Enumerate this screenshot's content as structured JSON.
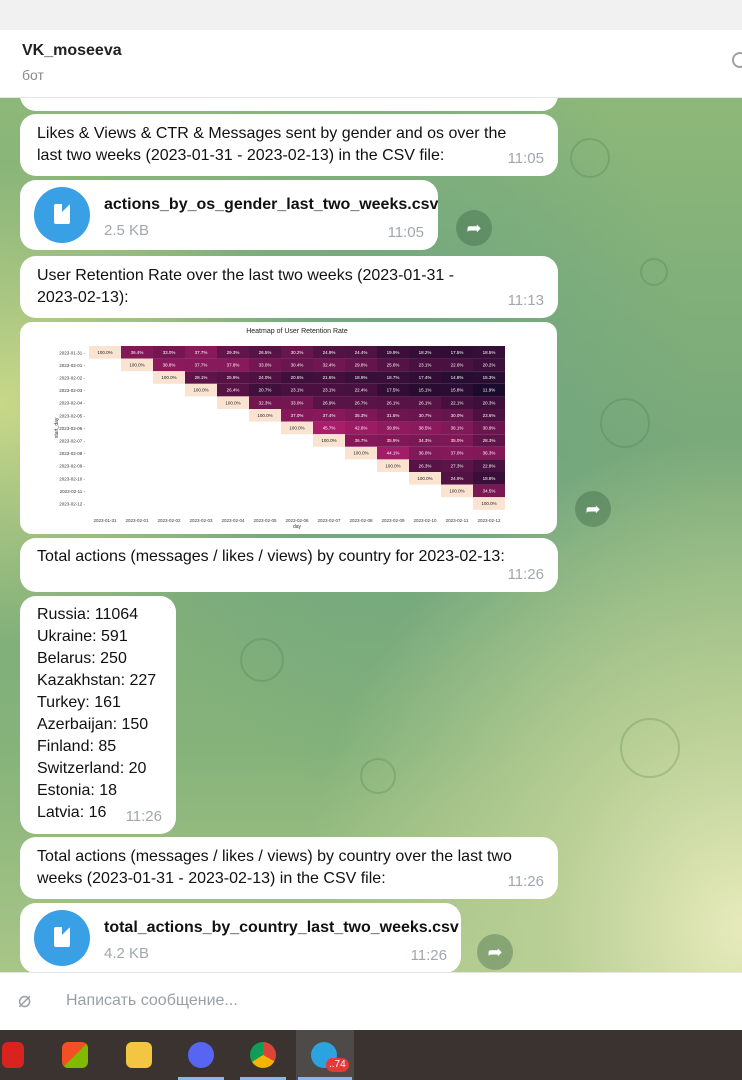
{
  "header": {
    "chat_name": "VK_moseeva",
    "chat_status": "бот"
  },
  "messages": [
    {
      "text": "Likes & Views & CTR & Messages sent by gender and os over the\nlast two weeks (2023-01-31 - 2023-02-13) in the CSV file:",
      "time": "11:05"
    },
    {
      "file_name": "actions_by_os_gender_last_two_weeks.csv",
      "file_size": "2.5 KB",
      "time": "11:05"
    },
    {
      "text": "User Retention Rate over the last two weeks (2023-01-31 -\n2023-02-13):",
      "time": "11:13"
    },
    {
      "text": "Total actions (messages / likes / views) by country for 2023-02-13:",
      "time": "11:26"
    },
    {
      "text": "Russia: 11064\nUkraine: 591\nBelarus: 250\nKazakhstan: 227\nTurkey: 161\nAzerbaijan: 150\nFinland: 85\nSwitzerland: 20\nEstonia: 18\nLatvia: 16",
      "time": "11:26"
    },
    {
      "text": "Total actions (messages / likes / views) by country over the last two\nweeks (2023-01-31 - 2023-02-13) in the CSV file:",
      "time": "11:26"
    },
    {
      "file_name": "total_actions_by_country_last_two_weeks.csv",
      "file_size": "4.2 KB",
      "time": "11:26"
    }
  ],
  "chart_data": {
    "type": "heatmap",
    "title": "Heatmap of User Retention Rate",
    "xlabel": "day",
    "ylabel": "start_day",
    "x": [
      "2023-01-31",
      "2023-02-01",
      "2023-02-02",
      "2023-02-03",
      "2023-02-04",
      "2023-02-05",
      "2023-02-06",
      "2023-02-07",
      "2023-02-08",
      "2023-02-09",
      "2023-02-10",
      "2023-02-11",
      "2023-02-12"
    ],
    "y": [
      "2023-01-31",
      "2023-02-01",
      "2023-02-02",
      "2023-02-03",
      "2023-02-04",
      "2023-02-05",
      "2023-02-06",
      "2023-02-07",
      "2023-02-08",
      "2023-02-09",
      "2023-02-10",
      "2023-02-11",
      "2023-02-12"
    ],
    "values": [
      [
        100.0,
        36.4,
        33.0,
        37.7,
        29.3,
        26.5,
        30.2,
        24.9,
        24.4,
        19.9,
        18.2,
        17.5,
        18.5
      ],
      [
        null,
        100.0,
        38.8,
        37.7,
        37.8,
        33.0,
        30.4,
        32.4,
        29.8,
        25.6,
        23.1,
        22.6,
        20.2
      ],
      [
        null,
        null,
        100.0,
        28.1,
        25.9,
        24.0,
        20.6,
        21.6,
        18.9,
        18.7,
        17.4,
        14.8,
        15.3
      ],
      [
        null,
        null,
        null,
        100.0,
        26.4,
        20.7,
        23.1,
        23.1,
        22.4,
        17.5,
        15.1,
        15.8,
        11.9
      ],
      [
        null,
        null,
        null,
        null,
        100.0,
        32.3,
        33.0,
        26.9,
        26.7,
        26.1,
        26.1,
        22.1,
        20.3
      ],
      [
        null,
        null,
        null,
        null,
        null,
        100.0,
        37.0,
        37.4,
        35.3,
        31.5,
        30.7,
        30.0,
        23.6
      ],
      [
        null,
        null,
        null,
        null,
        null,
        null,
        100.0,
        45.7,
        42.6,
        39.9,
        38.5,
        36.1,
        30.9
      ],
      [
        null,
        null,
        null,
        null,
        null,
        null,
        null,
        100.0,
        36.7,
        35.9,
        34.3,
        35.0,
        28.3
      ],
      [
        null,
        null,
        null,
        null,
        null,
        null,
        null,
        null,
        100.0,
        44.1,
        36.0,
        37.0,
        36.3
      ],
      [
        null,
        null,
        null,
        null,
        null,
        null,
        null,
        null,
        null,
        100.0,
        26.3,
        27.3,
        22.8
      ],
      [
        null,
        null,
        null,
        null,
        null,
        null,
        null,
        null,
        null,
        null,
        100.0,
        24.9,
        18.8
      ],
      [
        null,
        null,
        null,
        null,
        null,
        null,
        null,
        null,
        null,
        null,
        null,
        100.0,
        34.5
      ],
      [
        null,
        null,
        null,
        null,
        null,
        null,
        null,
        null,
        null,
        null,
        null,
        null,
        100.0
      ]
    ]
  },
  "composer": {
    "placeholder": "Написать сообщение..."
  },
  "taskbar": {
    "telegram_badge": "..74"
  }
}
